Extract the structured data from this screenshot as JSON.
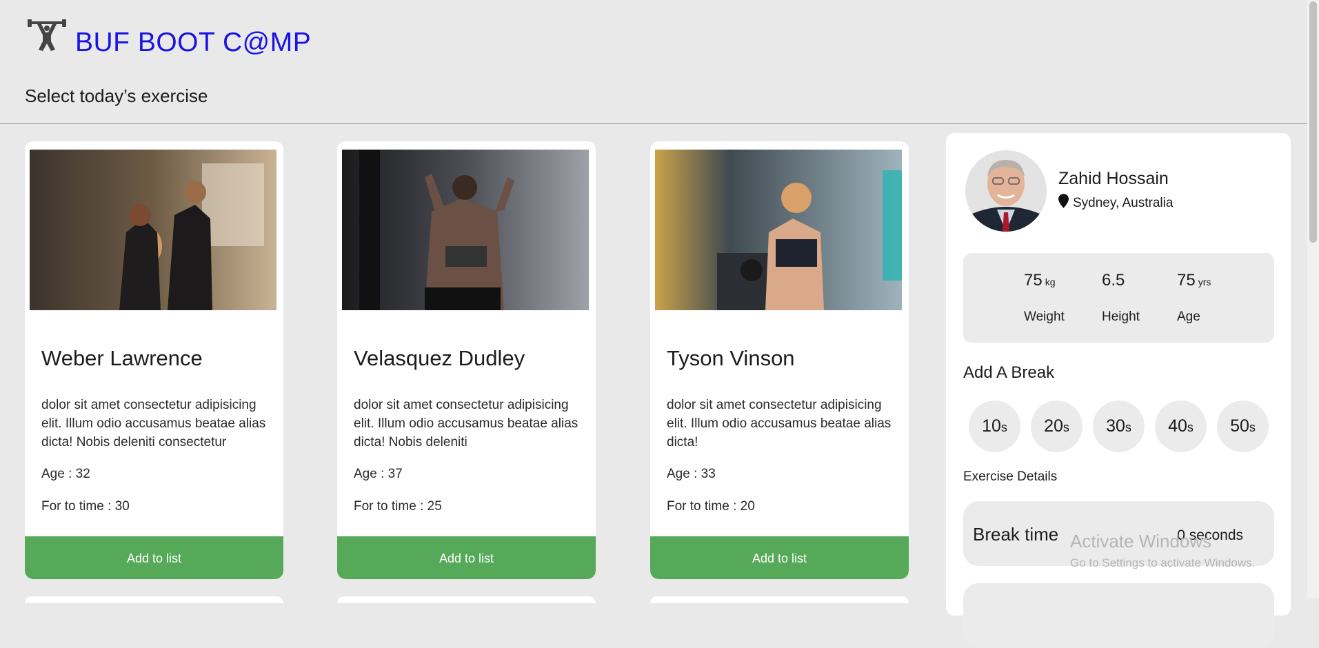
{
  "header": {
    "brand": "BUF BOOT C@MP",
    "logo_icon": "weightlifter-icon",
    "subtitle": "Select today’s exercise"
  },
  "cards": [
    {
      "name": "Weber Lawrence",
      "description": "dolor sit amet consectetur adipisicing elit. Illum odio accusamus beatae alias dicta! Nobis deleniti consectetur",
      "age": "Age : 32",
      "time": "For to time : 30",
      "button": "Add to list"
    },
    {
      "name": "Velasquez Dudley",
      "description": "dolor sit amet consectetur adipisicing elit. Illum odio accusamus beatae alias dicta! Nobis deleniti",
      "age": "Age : 37",
      "time": "For to time : 25",
      "button": "Add to list"
    },
    {
      "name": "Tyson Vinson",
      "description": "dolor sit amet consectetur adipisicing elit. Illum odio accusamus beatae alias dicta!",
      "age": "Age : 33",
      "time": "For to time : 20",
      "button": "Add to list"
    }
  ],
  "profile": {
    "name": "Zahid Hossain",
    "location": "Sydney, Australia",
    "location_icon": "map-pin-icon",
    "stats": [
      {
        "value": "75",
        "unit": "kg",
        "label": "Weight"
      },
      {
        "value": "6.5",
        "unit": "",
        "label": "Height"
      },
      {
        "value": "75",
        "unit": "yrs",
        "label": "Age"
      }
    ]
  },
  "breaks": {
    "title": "Add A Break",
    "options": [
      {
        "value": "10",
        "unit": "s"
      },
      {
        "value": "20",
        "unit": "s"
      },
      {
        "value": "30",
        "unit": "s"
      },
      {
        "value": "40",
        "unit": "s"
      },
      {
        "value": "50",
        "unit": "s"
      }
    ]
  },
  "details": {
    "title": "Exercise Details",
    "break_time_label": "Break time",
    "break_time_value": "0 seconds"
  },
  "watermark": {
    "line1": "Activate Windows",
    "line2": "Go to Settings to activate Windows."
  },
  "colors": {
    "brand": "#1a13e6",
    "button": "#55a958",
    "page_background": "#e9e9e9"
  }
}
